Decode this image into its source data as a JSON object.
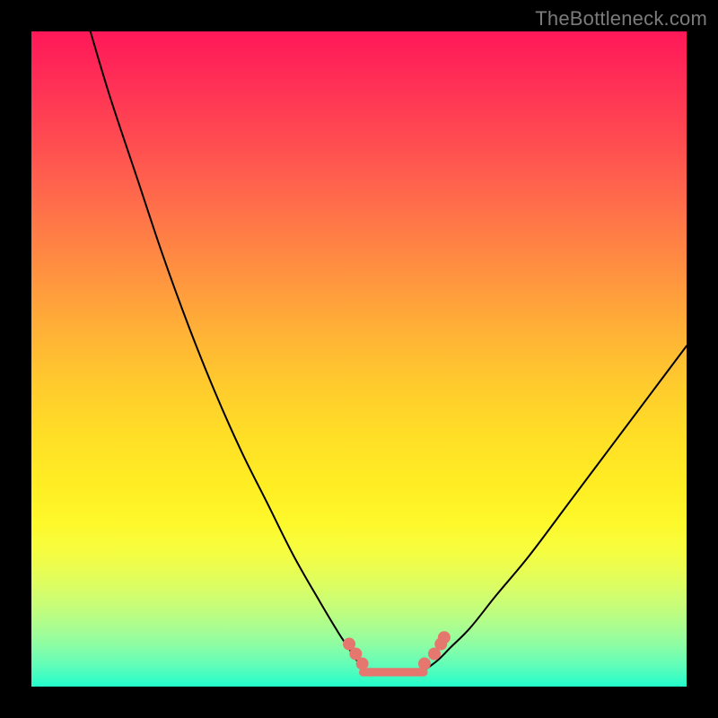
{
  "watermark": "TheBottleneck.com",
  "colors": {
    "frame": "#000000",
    "curve": "#000000",
    "marker": "#e6776f",
    "watermark": "#7b7b7b"
  },
  "chart_data": {
    "type": "line",
    "title": "",
    "xlabel": "",
    "ylabel": "",
    "xlim": [
      0,
      100
    ],
    "ylim": [
      0,
      100
    ],
    "grid": false,
    "legend": false,
    "series": [
      {
        "name": "left-curve",
        "x": [
          9,
          12,
          16,
          20,
          24,
          28,
          32,
          36,
          40,
          44,
          47,
          49,
          50,
          51
        ],
        "y": [
          100,
          90,
          78,
          66,
          55,
          45,
          36,
          28,
          20,
          13,
          8,
          5,
          3.5,
          2.5
        ]
      },
      {
        "name": "right-curve",
        "x": [
          60,
          62,
          64,
          67,
          71,
          76,
          82,
          88,
          94,
          100
        ],
        "y": [
          2.5,
          4,
          6,
          9,
          14,
          20,
          28,
          36,
          44,
          52
        ]
      },
      {
        "name": "floor",
        "x": [
          51,
          53,
          55,
          57,
          59,
          60
        ],
        "y": [
          2.2,
          2.1,
          2.1,
          2.1,
          2.2,
          2.4
        ]
      }
    ],
    "markers": [
      {
        "x": 48.5,
        "y": 6.5
      },
      {
        "x": 49.5,
        "y": 5.0
      },
      {
        "x": 50.5,
        "y": 3.5
      },
      {
        "x": 60.0,
        "y": 3.5
      },
      {
        "x": 61.5,
        "y": 5.0
      },
      {
        "x": 62.5,
        "y": 6.5
      },
      {
        "x": 63.0,
        "y": 7.5
      }
    ],
    "floor_band": {
      "x0": 50.0,
      "x1": 60.5,
      "y": 2.2,
      "thickness": 1.3
    },
    "background_gradient": {
      "stops": [
        {
          "pos": 0.0,
          "color": "#ff1858"
        },
        {
          "pos": 0.5,
          "color": "#ffc130"
        },
        {
          "pos": 0.75,
          "color": "#fdf92b"
        },
        {
          "pos": 1.0,
          "color": "#22fdca"
        }
      ]
    }
  }
}
